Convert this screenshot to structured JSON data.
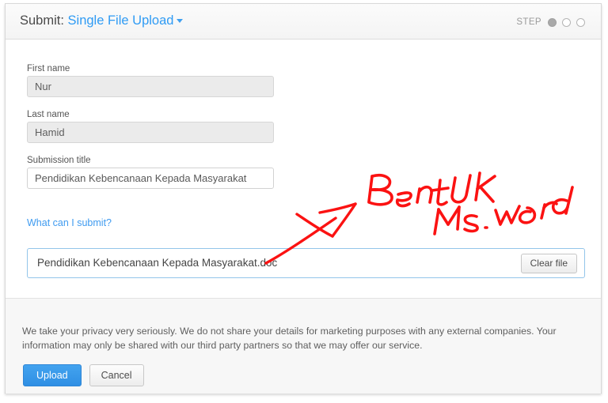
{
  "header": {
    "prefix": "Submit:",
    "mode": "Single File Upload",
    "caret_icon": "chevron-down-icon",
    "step_label": "STEP",
    "steps": [
      {
        "state": "filled"
      },
      {
        "state": "empty"
      },
      {
        "state": "empty"
      }
    ]
  },
  "form": {
    "first_name": {
      "label": "First name",
      "value": "Nur",
      "placeholder": "First name",
      "readonly": true
    },
    "last_name": {
      "label": "Last name",
      "value": "Hamid",
      "placeholder": "Last name",
      "readonly": true
    },
    "submission_title": {
      "label": "Submission title",
      "value": "Pendidikan Kebencanaan Kepada Masyarakat",
      "placeholder": "Submission title",
      "readonly": false
    },
    "help_link": "What can I submit?",
    "file": {
      "name": "Pendidikan Kebencanaan Kepada Masyarakat.doc",
      "clear_label": "Clear file"
    }
  },
  "footer": {
    "privacy": "We take your privacy very seriously. We do not share your details for marketing purposes with any external companies. Your information may only be shared with our third party partners so that we may offer our service.",
    "upload_label": "Upload",
    "cancel_label": "Cancel"
  },
  "annotation": {
    "color": "#fb1212",
    "line1": "BentUK",
    "line2": "Ms.word",
    "arrow": "arrow-pointing-to-filename"
  },
  "colors": {
    "accent_blue": "#2f9bf4",
    "button_blue": "#3898e8",
    "annotation_red": "#fb1212",
    "panel_border": "#d8d8d8",
    "footer_bg": "#f7f7f7",
    "readonly_field_bg": "#ebebeb"
  }
}
